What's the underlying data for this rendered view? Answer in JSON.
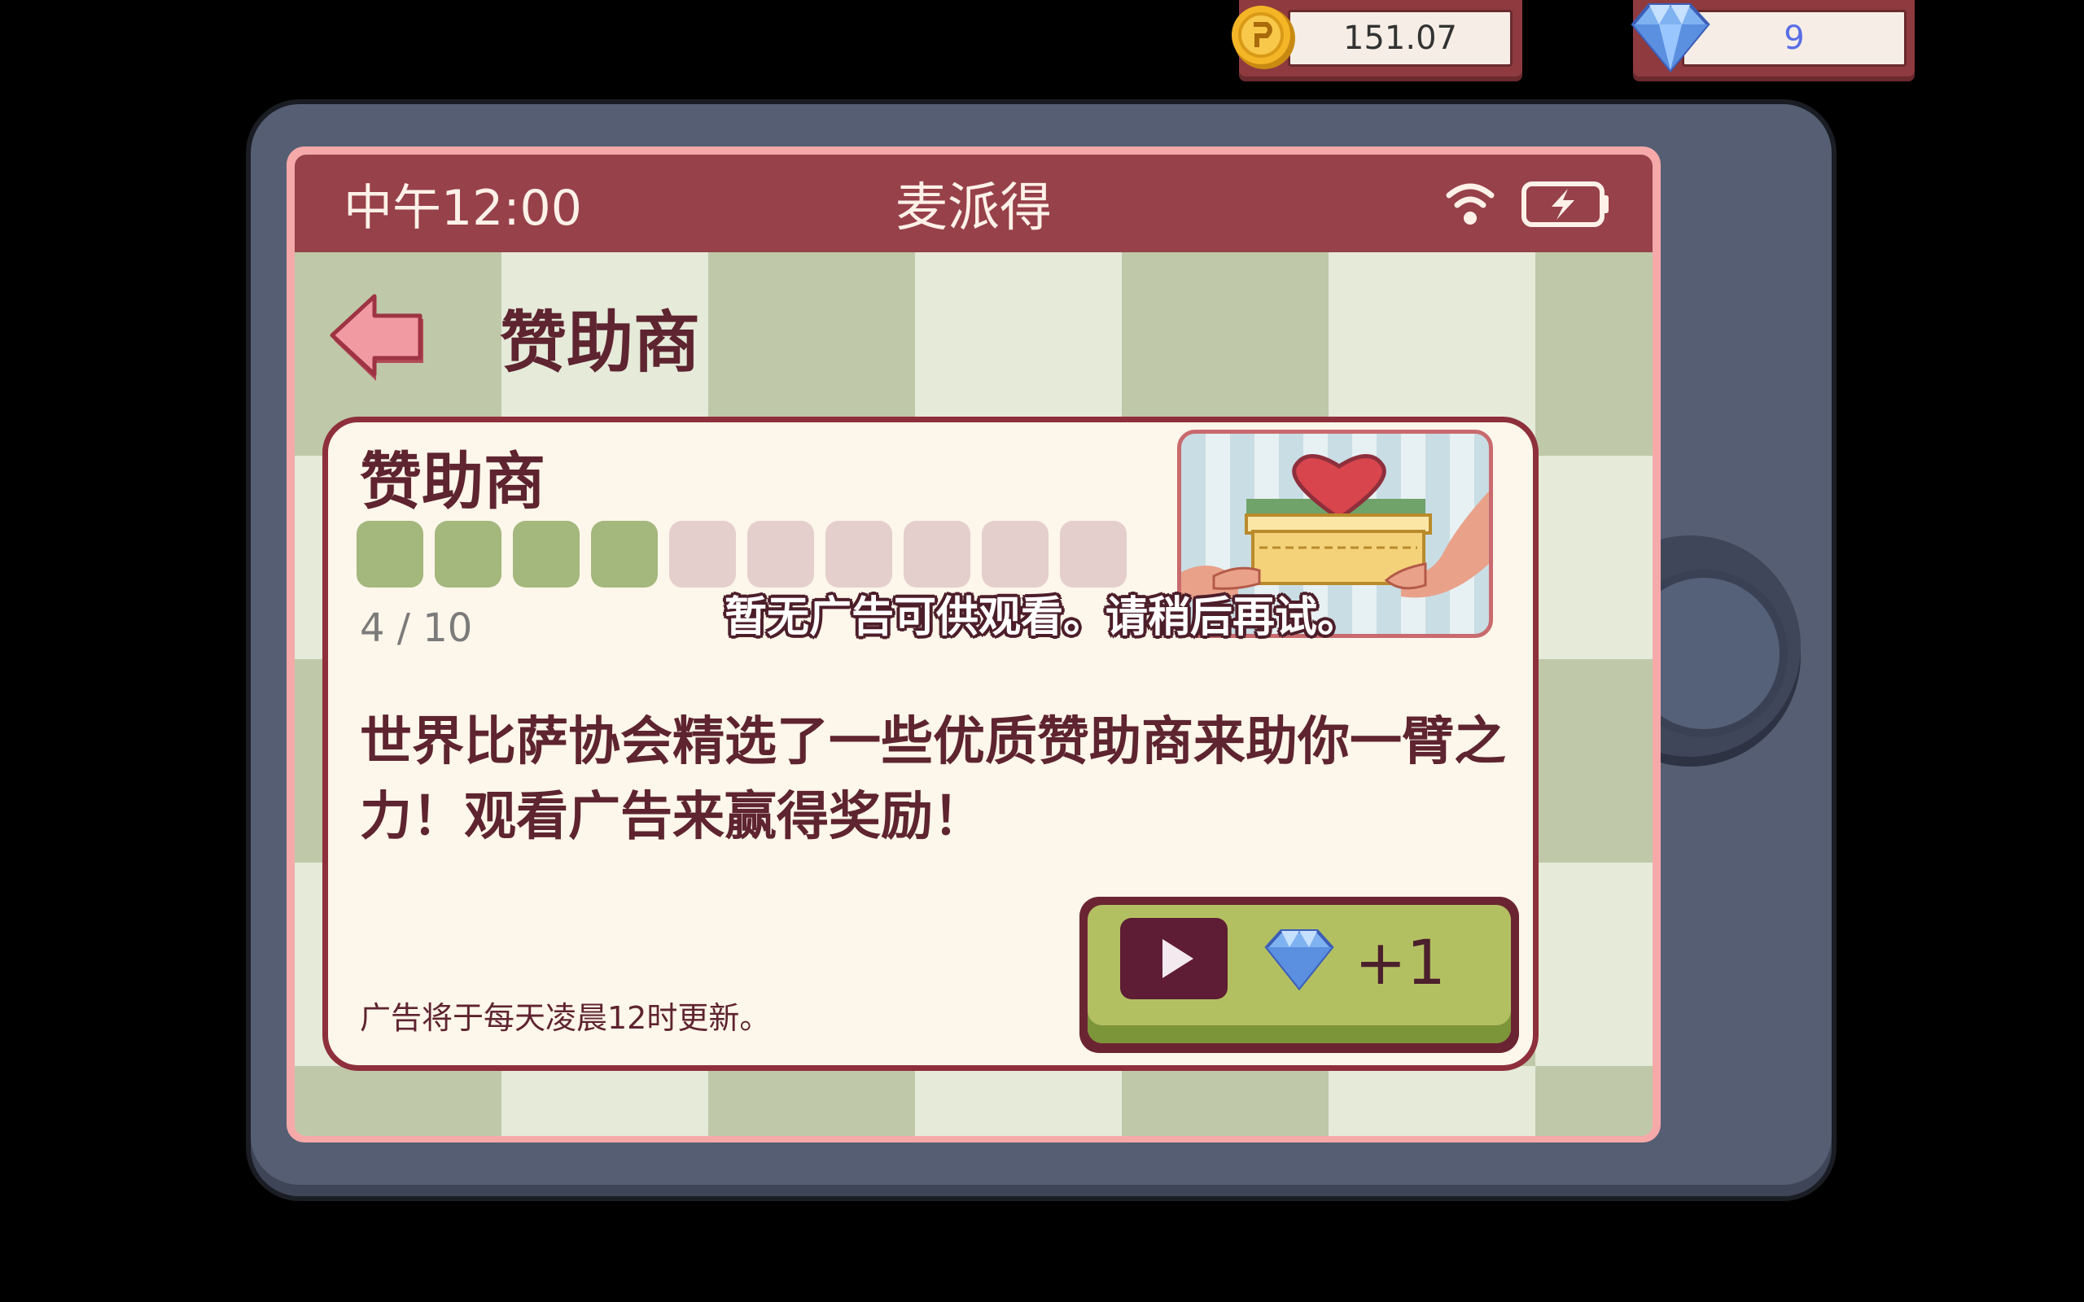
{
  "currency": {
    "coins": "151.07",
    "gems": "9"
  },
  "status_bar": {
    "time": "中午12:00",
    "app_name": "麦派得"
  },
  "page": {
    "title": "赞助商"
  },
  "card": {
    "title": "赞助商",
    "progress_current": 4,
    "progress_total": 10,
    "progress_text": "4  /  10",
    "description": "世界比萨协会精选了一些优质赞助商来助你一臂之力！观看广告来赢得奖励！",
    "footnote": "广告将于每天凌晨12时更新。"
  },
  "ad_button": {
    "reward_label": "+1",
    "icons": [
      "play-icon",
      "gem-icon"
    ]
  },
  "toast": "暂无广告可供观看。请稍后再试。",
  "colors": {
    "status_bar": "#97414a",
    "progress_on": "#a4b77d",
    "progress_off": "#e4cfcd",
    "button_green": "#b3c062",
    "text_dark": "#5e2430"
  }
}
